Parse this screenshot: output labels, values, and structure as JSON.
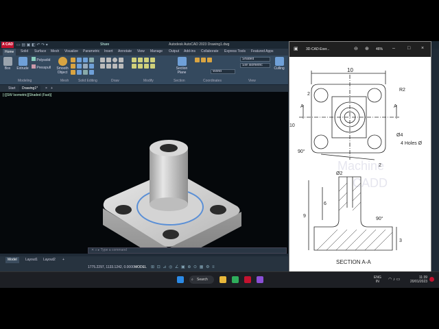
{
  "app": {
    "logo": "A CAD",
    "title": "Autodesk AutoCAD 2023   Drawing1.dwg",
    "share": "Share"
  },
  "ribbon_tabs": [
    "Home",
    "Solid",
    "Surface",
    "Mesh",
    "Visualize",
    "Parametric",
    "Insert",
    "Annotate",
    "View",
    "Manage",
    "Output",
    "Add-ins",
    "Collaborate",
    "Express Tools",
    "Featured Apps"
  ],
  "ribbon": {
    "box": "Box",
    "extrude": "Extrude",
    "polysolid": "Polysolid",
    "presspull": "Presspull",
    "smooth_object": "Smooth Object",
    "section_plane": "Section Plane",
    "culling": "Culling",
    "visual_style": "Shaded",
    "view_preset": "SW Isometric",
    "ucs": "World",
    "panels": [
      "Modeling",
      "Mesh",
      "Solid Editing",
      "Draw",
      "Modify",
      "Section",
      "Coordinates",
      "View"
    ]
  },
  "file_tabs": [
    "Start",
    "Drawing1*"
  ],
  "viewport": {
    "label": "[-][SW Isometric][Shaded (Fast)]"
  },
  "command": {
    "placeholder": "Type a command"
  },
  "layout_tabs": [
    "Model",
    "Layout1",
    "Layout2"
  ],
  "status": {
    "coords": "1775.2297, 1133.1242, 0.0000",
    "mode": "MODEL"
  },
  "taskbar": {
    "search": "Search",
    "lang1": "ENG",
    "lang2": "IN",
    "time": "11:39",
    "date": "20/01/2023"
  },
  "viewer": {
    "title": "3D-CAD-Exer...",
    "zoom": "46%",
    "dims": {
      "top_width": "10",
      "radius": "R2",
      "offset": "2",
      "left_edge": "10",
      "hole_dia": "Ø4",
      "holes_note": "4 Holes Ø",
      "angle_plan": "90°",
      "bottom_offset": "2",
      "top_dia": "Ø2",
      "height_inner": "6",
      "height_total": "9",
      "angle_section": "90°",
      "base_height": "3",
      "section_mark": "A"
    },
    "section_title": "SECTION A-A",
    "watermark1": "Machine",
    "watermark2": "CADD"
  },
  "colors": {
    "accent": "#c4122f",
    "ribbon": "#34495e",
    "viewport_bg": "#05080b"
  }
}
